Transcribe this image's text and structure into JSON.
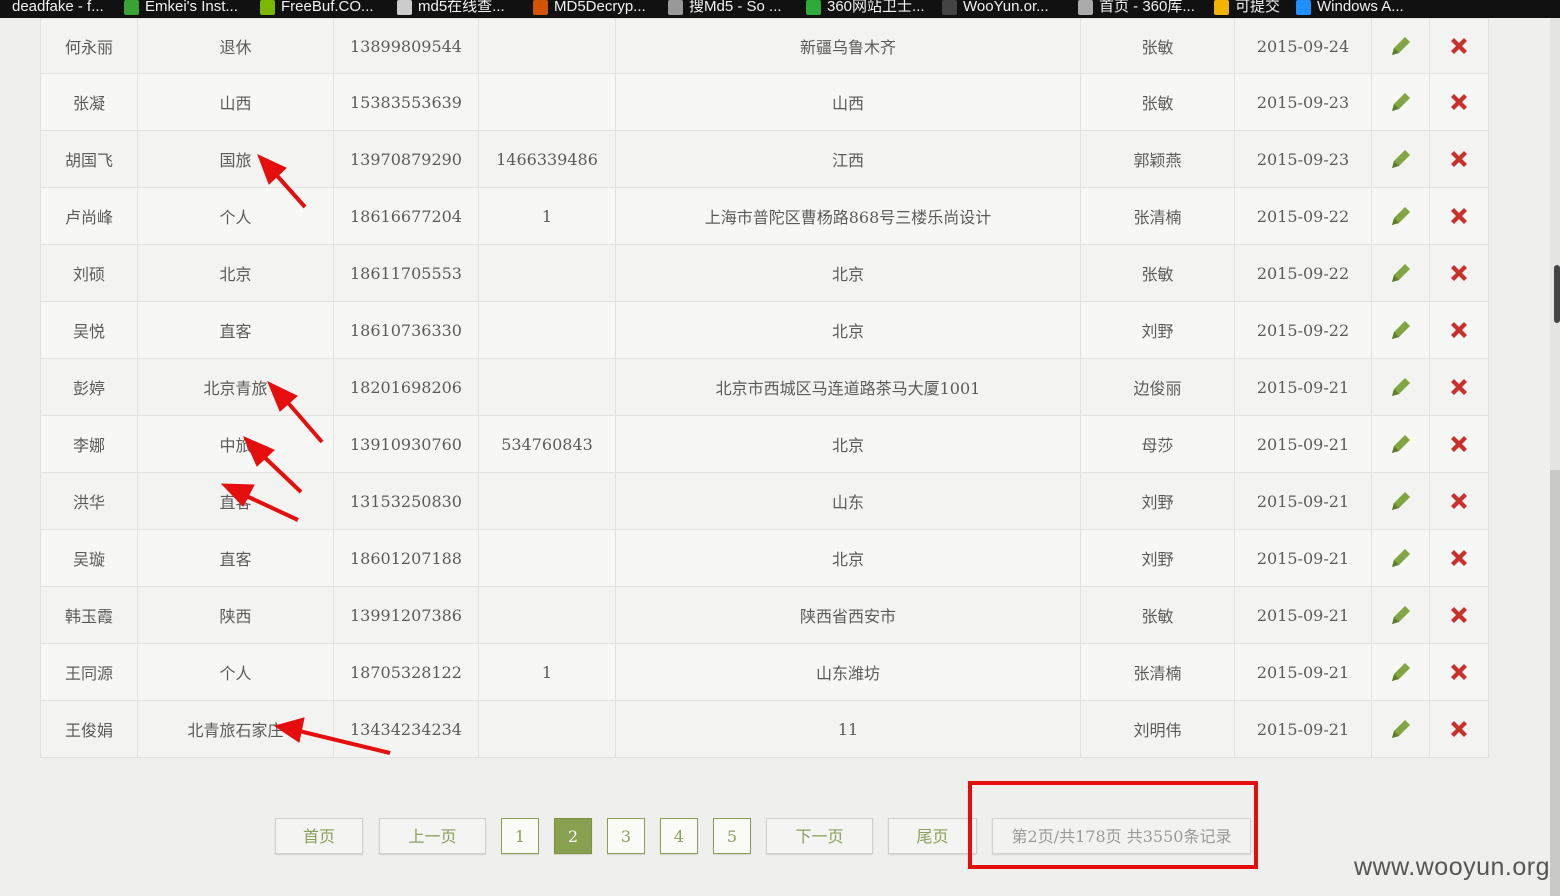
{
  "bookmarks": [
    {
      "label": "deadfake - f...",
      "icon": "page-icon",
      "color": "#2b5797"
    },
    {
      "label": "Emkei's Inst...",
      "icon": "globe-icon",
      "color": "#3aa335"
    },
    {
      "label": "FreeBuf.CO...",
      "icon": "freebuf-icon",
      "color": "#7ab800"
    },
    {
      "label": "md5在线查...",
      "icon": "grid-icon",
      "color": "#cccccc"
    },
    {
      "label": "MD5Decryp...",
      "icon": "flame-icon",
      "color": "#d35400"
    },
    {
      "label": "搜Md5 - So ...",
      "icon": "md5-icon",
      "color": "#999999"
    },
    {
      "label": "360网站卫士...",
      "icon": "shield-icon",
      "color": "#2eaa3a"
    },
    {
      "label": "WooYun.or...",
      "icon": "globe-icon",
      "color": "#444444"
    },
    {
      "label": "首页 - 360库...",
      "icon": "star-icon",
      "color": "#aaaaaa"
    },
    {
      "label": "可提交",
      "icon": "folder-icon",
      "color": "#f2b400"
    },
    {
      "label": "Windows A...",
      "icon": "windows-icon",
      "color": "#1e90ff"
    }
  ],
  "table": {
    "rows": [
      {
        "name": "何永丽",
        "type": "退休",
        "phone": "13899809544",
        "qq": "",
        "address": "新疆乌鲁木齐",
        "staff": "张敏",
        "date": "2015-09-24"
      },
      {
        "name": "张凝",
        "type": "山西",
        "phone": "15383553639",
        "qq": "",
        "address": "山西",
        "staff": "张敏",
        "date": "2015-09-23"
      },
      {
        "name": "胡国飞",
        "type": "国旅",
        "phone": "13970879290",
        "qq": "1466339486",
        "address": "江西",
        "staff": "郭颖燕",
        "date": "2015-09-23"
      },
      {
        "name": "卢尚峰",
        "type": "个人",
        "phone": "18616677204",
        "qq": "1",
        "address": "上海市普陀区曹杨路868号三楼乐尚设计",
        "staff": "张清楠",
        "date": "2015-09-22"
      },
      {
        "name": "刘硕",
        "type": "北京",
        "phone": "18611705553",
        "qq": "",
        "address": "北京",
        "staff": "张敏",
        "date": "2015-09-22"
      },
      {
        "name": "吴悦",
        "type": "直客",
        "phone": "18610736330",
        "qq": "",
        "address": "北京",
        "staff": "刘野",
        "date": "2015-09-22"
      },
      {
        "name": "彭婷",
        "type": "北京青旅",
        "phone": "18201698206",
        "qq": "",
        "address": "北京市西城区马连道路茶马大厦1001",
        "staff": "边俊丽",
        "date": "2015-09-21"
      },
      {
        "name": "李娜",
        "type": "中旅",
        "phone": "13910930760",
        "qq": "534760843",
        "address": "北京",
        "staff": "母莎",
        "date": "2015-09-21"
      },
      {
        "name": "洪华",
        "type": "直客",
        "phone": "13153250830",
        "qq": "",
        "address": "山东",
        "staff": "刘野",
        "date": "2015-09-21"
      },
      {
        "name": "吴璇",
        "type": "直客",
        "phone": "18601207188",
        "qq": "",
        "address": "北京",
        "staff": "刘野",
        "date": "2015-09-21"
      },
      {
        "name": "韩玉霞",
        "type": "陕西",
        "phone": "13991207386",
        "qq": "",
        "address": "陕西省西安市",
        "staff": "张敏",
        "date": "2015-09-21"
      },
      {
        "name": "王同源",
        "type": "个人",
        "phone": "18705328122",
        "qq": "1",
        "address": "山东潍坊",
        "staff": "张清楠",
        "date": "2015-09-21"
      },
      {
        "name": "王俊娟",
        "type": "北青旅石家庄",
        "phone": "13434234234",
        "qq": "",
        "address": "11",
        "staff": "刘明伟",
        "date": "2015-09-21"
      }
    ]
  },
  "pagination": {
    "first": "首页",
    "prev": "上一页",
    "pages": [
      "1",
      "2",
      "3",
      "4",
      "5"
    ],
    "current": "2",
    "next": "下一页",
    "last": "尾页",
    "info": "第2页/共178页 共3550条记录"
  },
  "watermark": "www.wooyun.org",
  "colors": {
    "accent": "#88a04f",
    "edit_icon": "#7fa640",
    "delete_icon": "#c9302c",
    "annotation": "#e60d0d"
  }
}
